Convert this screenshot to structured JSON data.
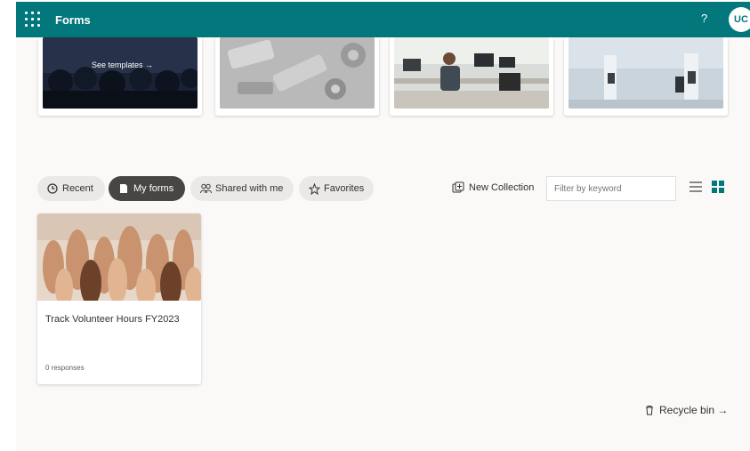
{
  "header": {
    "app_name": "Forms",
    "help": "?",
    "avatar_initials": "UC",
    "accent_color": "#03787c"
  },
  "templates": {
    "see_templates_label": "See templates →"
  },
  "pivots": [
    {
      "label": "Recent",
      "icon": "clock-icon",
      "active": false
    },
    {
      "label": "My forms",
      "icon": "form-icon",
      "active": true
    },
    {
      "label": "Shared with me",
      "icon": "people-icon",
      "active": false
    },
    {
      "label": "Favorites",
      "icon": "star-icon",
      "active": false
    }
  ],
  "toolbar": {
    "new_collection": "New Collection",
    "filter_placeholder": "Filter by keyword"
  },
  "forms": [
    {
      "title": "Track Volunteer Hours FY2023",
      "responses": "0 responses"
    }
  ],
  "footer": {
    "recycle_bin": "Recycle bin →"
  }
}
